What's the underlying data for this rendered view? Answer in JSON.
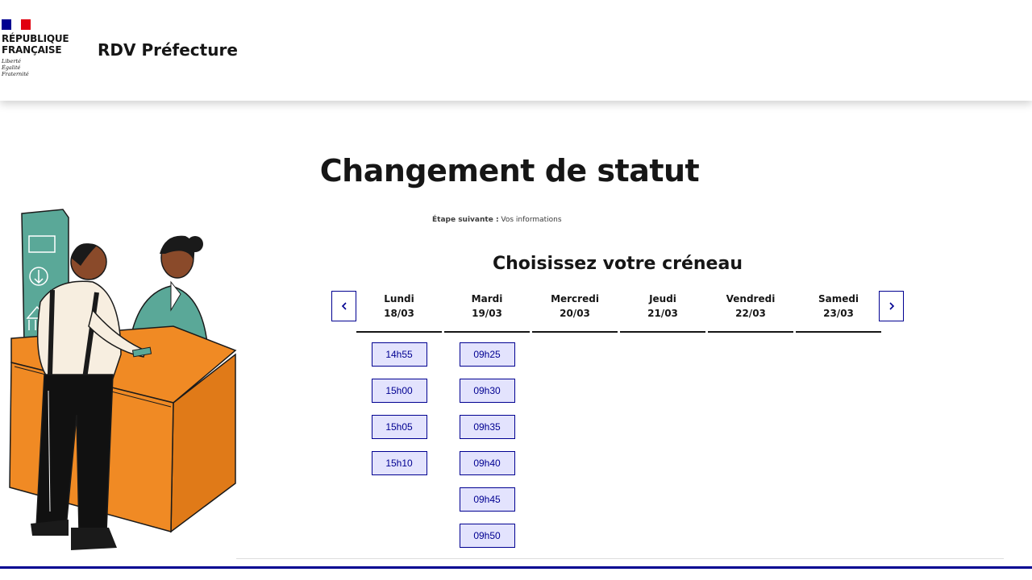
{
  "header": {
    "logo_line1": "RÉPUBLIQUE",
    "logo_line2": "FRANÇAISE",
    "motto": [
      "Liberté",
      "Égalité",
      "Fraternité"
    ],
    "site_title": "RDV Préfecture"
  },
  "main": {
    "title": "Changement de statut",
    "next_step_label": "Étape suivante :",
    "next_step_value": "Vos informations",
    "section_title": "Choisissez votre créneau"
  },
  "calendar": {
    "days": [
      {
        "name": "Lundi",
        "date": "18/03",
        "slots": [
          "14h55",
          "15h00",
          "15h05",
          "15h10"
        ]
      },
      {
        "name": "Mardi",
        "date": "19/03",
        "slots": [
          "09h25",
          "09h30",
          "09h35",
          "09h40",
          "09h45",
          "09h50"
        ]
      },
      {
        "name": "Mercredi",
        "date": "20/03",
        "slots": []
      },
      {
        "name": "Jeudi",
        "date": "21/03",
        "slots": []
      },
      {
        "name": "Vendredi",
        "date": "22/03",
        "slots": []
      },
      {
        "name": "Samedi",
        "date": "23/03",
        "slots": []
      }
    ]
  },
  "colors": {
    "primary_blue": "#000091",
    "slot_bg": "#e3e3fd",
    "flag_red": "#e1000f",
    "desk_orange": "#f08a24",
    "teal": "#5aa898"
  },
  "icons": [
    "chevron-left-icon",
    "chevron-right-icon"
  ]
}
